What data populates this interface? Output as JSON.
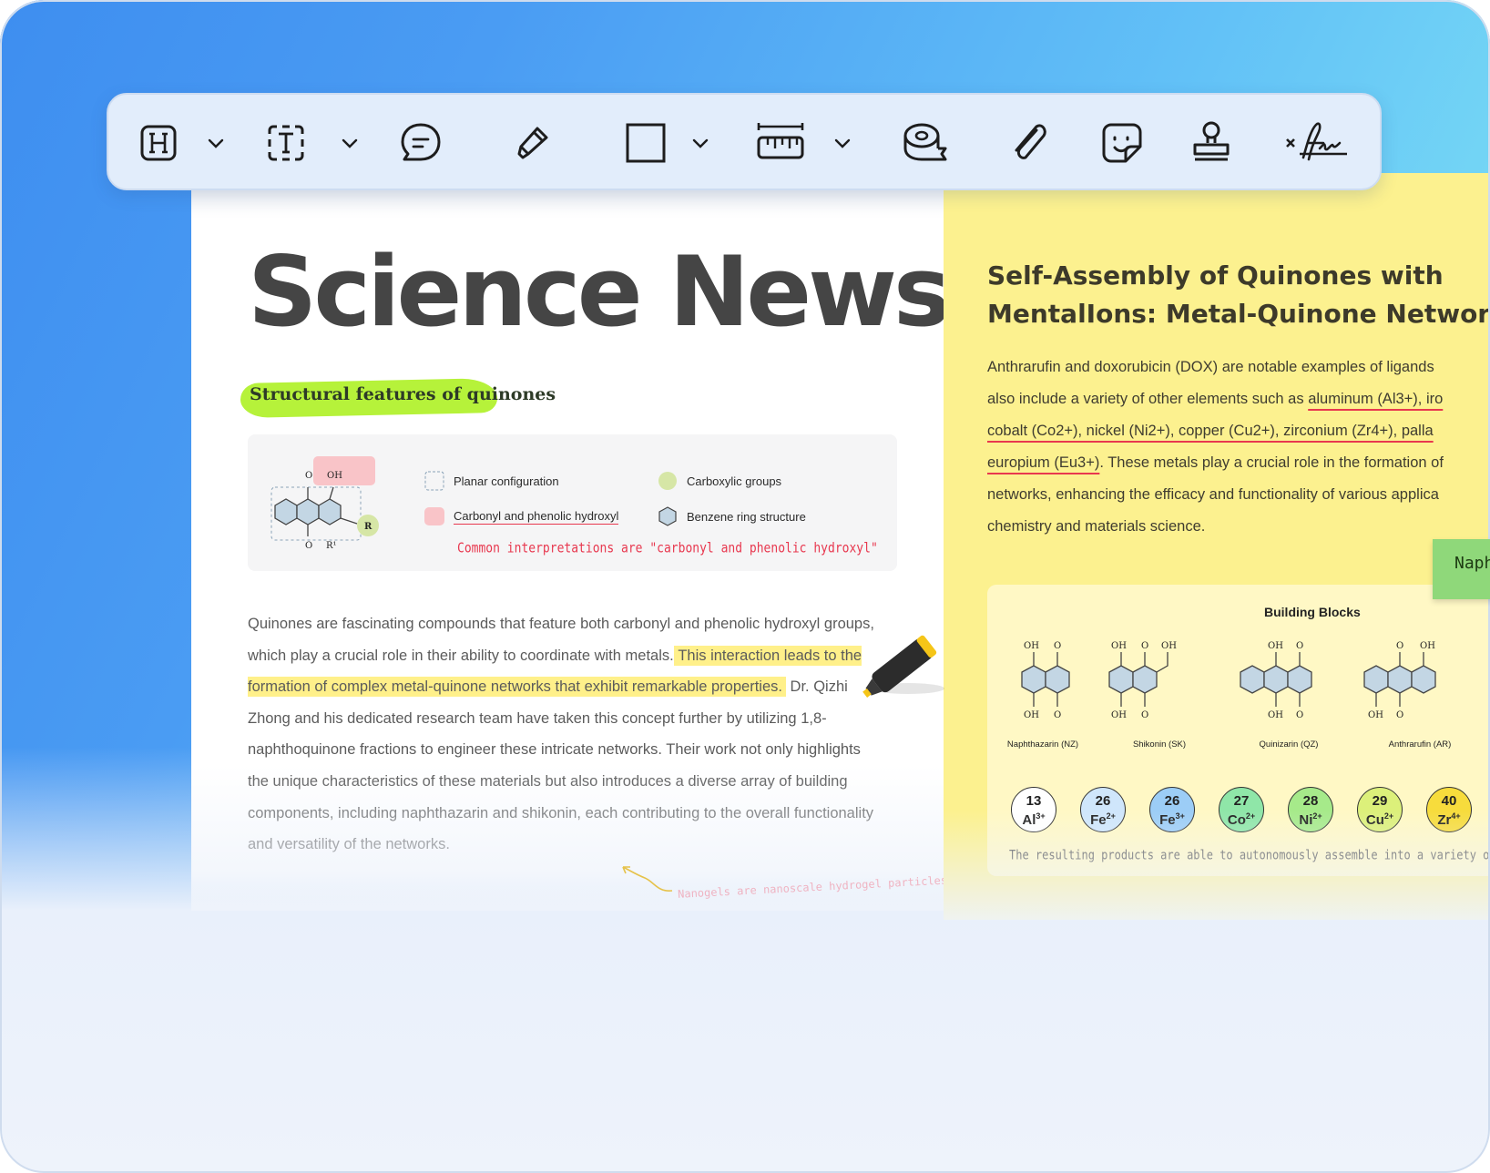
{
  "toolbar": {
    "tools": [
      {
        "name": "header-tool",
        "icon": "heading-icon"
      },
      {
        "name": "text-tool",
        "icon": "text-box-icon"
      },
      {
        "name": "comment-tool",
        "icon": "speech-bubble-icon"
      },
      {
        "name": "highlighter-tool",
        "icon": "highlighter-pen-icon"
      },
      {
        "name": "shape-tool",
        "icon": "rectangle-icon"
      },
      {
        "name": "measure-tool",
        "icon": "ruler-icon"
      },
      {
        "name": "tape-tool",
        "icon": "tape-roll-icon"
      },
      {
        "name": "attachment-tool",
        "icon": "paperclip-icon"
      },
      {
        "name": "sticker-tool",
        "icon": "sticker-icon"
      },
      {
        "name": "stamp-tool",
        "icon": "stamp-icon"
      },
      {
        "name": "signature-tool",
        "icon": "signature-icon"
      }
    ]
  },
  "left": {
    "title": "Science News",
    "subtitle": "Structural features of quinones",
    "legend": {
      "items": [
        {
          "label": "Planar configuration",
          "swatch": "dashed-square"
        },
        {
          "label": "Carboxylic groups",
          "swatch": "green-circle"
        },
        {
          "label": "Carbonyl and phenolic hydroxyl",
          "swatch": "pink-square"
        },
        {
          "label": "Benzene ring structure",
          "swatch": "hexagon"
        }
      ],
      "note": "Common interpretations are \"carbonyl and phenolic hydroxyl\"",
      "molecule_labels": {
        "o_top": "O",
        "oh_top": "OH",
        "o_bottom": "O",
        "r1": "R¹",
        "r": "R"
      }
    },
    "body": {
      "p1": "Quinones are fascinating compounds that feature both carbonyl and phenolic hydroxyl groups, which play a crucial role in their ability to coordinate with metals.",
      "highlight": "This interaction leads to the formation of complex metal-quinone networks that exhibit remarkable properties.",
      "p2": "Dr. Qizhi Zhong and his dedicated research team have taken this concept further by utilizing 1,8-naphthoquinone fractions to engineer these intricate networks. Their work not only highlights the unique characteristics of these materials but also introduces a diverse array of building components, including naphthazarin and shikonin, each contributing to the overall functionality and versatility of the networks."
    },
    "handwritten_note": "Nanogels are nanoscale hydrogel particles."
  },
  "right": {
    "title_line1": "Self-Assembly of Quinones with",
    "title_line2": "MentalIons: Metal-Quinone Networks",
    "body": {
      "s1": "Anthrarufin and doxorubicin (DOX) are notable examples of ligands",
      "s2a": "also include a variety of other elements such as ",
      "u1": "aluminum (Al3+), iro",
      "u2": "cobalt (Co2+), nickel (Ni2+), copper (Cu2+), zirconium (Zr4+), palla",
      "u3": "europium (Eu3+)",
      "s3": ". These metals play a crucial role in the formation of",
      "s4": "networks, enhancing the efficacy and functionality of various applica",
      "s5": "chemistry and materials science."
    },
    "sticky_note": "Naphth",
    "building_blocks": {
      "title": "Building Blocks",
      "molecules": [
        {
          "name": "Naphthazarin (NZ)",
          "top": [
            "OH",
            "O"
          ],
          "bottom": [
            "OH",
            "O"
          ]
        },
        {
          "name": "Shikonin (SK)",
          "top": [
            "OH",
            "O",
            "OH"
          ],
          "bottom": [
            "OH",
            "O"
          ]
        },
        {
          "name": "Quinizarin (QZ)",
          "top": [
            "OH",
            "O"
          ],
          "bottom": [
            "OH",
            "O"
          ]
        },
        {
          "name": "Anthrarufin (AR)",
          "top": [
            "O",
            "OH"
          ],
          "bottom": [
            "OH",
            "O"
          ]
        }
      ],
      "ions": [
        {
          "number": "13",
          "symbol": "Al",
          "charge": "3+",
          "color": "#ffffff"
        },
        {
          "number": "26",
          "symbol": "Fe",
          "charge": "2+",
          "color": "#cfe6fb"
        },
        {
          "number": "26",
          "symbol": "Fe",
          "charge": "3+",
          "color": "#9ccdf6"
        },
        {
          "number": "27",
          "symbol": "Co",
          "charge": "2+",
          "color": "#8fe6a8"
        },
        {
          "number": "28",
          "symbol": "Ni",
          "charge": "2+",
          "color": "#a6ea8a"
        },
        {
          "number": "29",
          "symbol": "Cu",
          "charge": "2+",
          "color": "#dcf07a"
        },
        {
          "number": "40",
          "symbol": "Zr",
          "charge": "4+",
          "color": "#f7dc3c"
        }
      ],
      "note": "The resulting products are able to autonomously assemble into a variety of structures including particle"
    }
  },
  "colors": {
    "highlight": "#fff08a",
    "marker_green": "#b6f23a",
    "accent_red": "#e8384f",
    "right_paper": "#fcf18f"
  }
}
